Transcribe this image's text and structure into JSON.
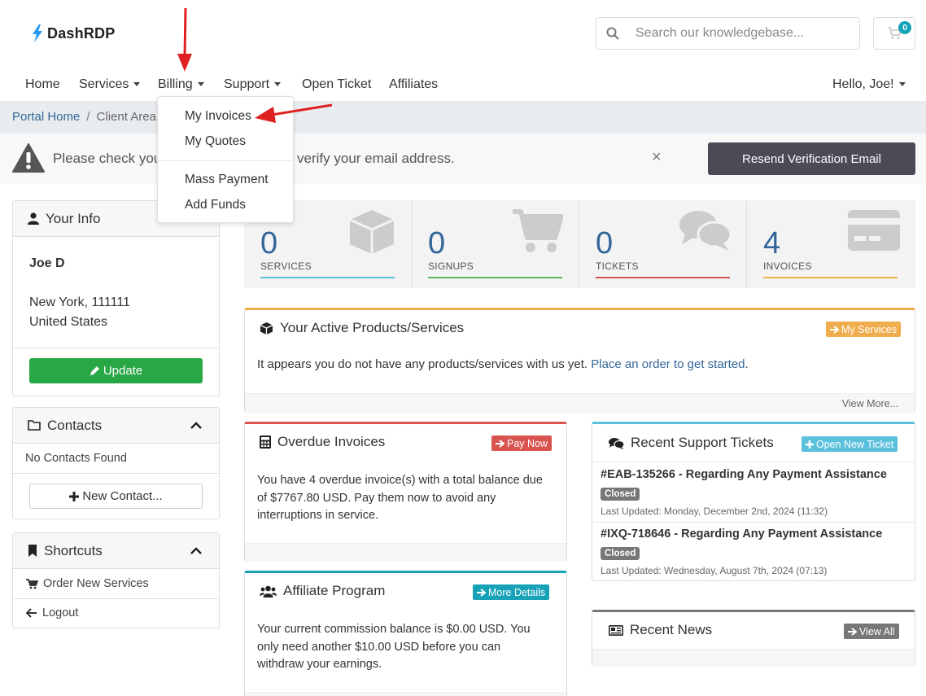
{
  "brand": {
    "name": "DashRDP"
  },
  "search": {
    "placeholder": "Search our knowledgebase..."
  },
  "cart": {
    "count": "0"
  },
  "nav": {
    "home": "Home",
    "services": "Services",
    "billing": "Billing",
    "support": "Support",
    "open_ticket": "Open Ticket",
    "affiliates": "Affiliates",
    "user": "Hello, Joe!"
  },
  "billing_menu": {
    "items": [
      "My Invoices",
      "My Quotes",
      "Mass Payment",
      "Add Funds"
    ]
  },
  "breadcrumb": {
    "home": "Portal Home",
    "separator": "/",
    "current": "Client Area"
  },
  "alert": {
    "text_start": "Please check your",
    "text_end": "k to verify your email address.",
    "close": "×",
    "resend_label": "Resend Verification Email"
  },
  "your_info": {
    "title": "Your Info",
    "name": "Joe D",
    "city_line": "New York, 111111",
    "country": "United States",
    "update_label": "Update"
  },
  "contacts": {
    "title": "Contacts",
    "empty": "No Contacts Found",
    "new_label": "New Contact..."
  },
  "shortcuts": {
    "title": "Shortcuts",
    "order": "Order New Services",
    "logout": "Logout"
  },
  "stats": [
    {
      "value": "0",
      "label": "SERVICES",
      "color": "#5bc0de"
    },
    {
      "value": "0",
      "label": "SIGNUPS",
      "color": "#5cb85c"
    },
    {
      "value": "0",
      "label": "TICKETS",
      "color": "#d9534f"
    },
    {
      "value": "4",
      "label": "INVOICES",
      "color": "#f0ad4e"
    }
  ],
  "products": {
    "title": "Your Active Products/Services",
    "badge": "My Services",
    "text": "It appears you do not have any products/services with us yet.",
    "link": "Place an order to get started",
    "period": ".",
    "view_more": "View More..."
  },
  "overdue": {
    "title": "Overdue Invoices",
    "badge": "Pay Now",
    "line1": "You have 4 overdue invoice(s) with a total balance due",
    "line2": "of $7767.80 USD. Pay them now to avoid any",
    "line3": "interruptions in service."
  },
  "affiliate": {
    "title": "Affiliate Program",
    "badge": "More Details",
    "line1": "Your current commission balance is $0.00 USD. You",
    "line2": "only need another $10.00 USD before you can",
    "line3": "withdraw your earnings."
  },
  "tickets": {
    "title": "Recent Support Tickets",
    "badge": "Open New Ticket",
    "items": [
      {
        "subject": "#EAB-135266 - Regarding Any Payment Assistance",
        "status": "Closed",
        "updated": "Last Updated: Monday, December 2nd, 2024 (11:32)"
      },
      {
        "subject": "#IXQ-718646 - Regarding Any Payment Assistance",
        "status": "Closed",
        "updated": "Last Updated: Wednesday, August 7th, 2024 (07:13)"
      }
    ]
  },
  "news": {
    "title": "Recent News",
    "badge": "View All"
  },
  "colors": {
    "accent": "#336699",
    "green": "#28a745",
    "red_badge": "#d9534f",
    "orange_badge": "#f0ad4e",
    "teal_badge": "#17a2b8",
    "info_badge": "#5bc0de",
    "gray_badge": "#777777",
    "annotation_arrow": "#e02020"
  }
}
